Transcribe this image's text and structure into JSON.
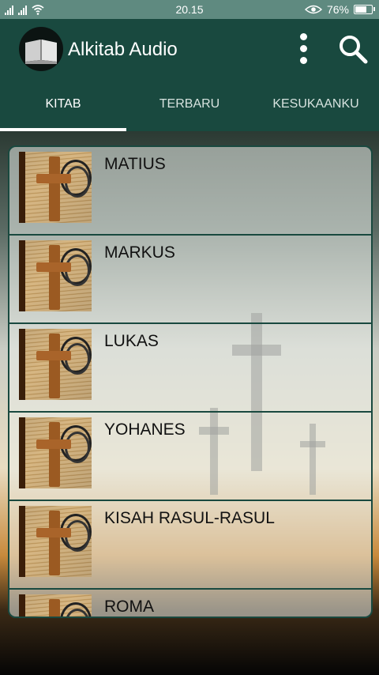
{
  "status_bar": {
    "time": "20.15",
    "battery": "76%",
    "battery_level": 0.76
  },
  "app_bar": {
    "title": "Alkitab Audio",
    "logo_icon": "bible-book-icon",
    "more_icon": "more-vert-icon",
    "search_icon": "search-icon",
    "background": "#19493f"
  },
  "tabs": [
    {
      "label": "KITAB",
      "active": true
    },
    {
      "label": "TERBARU",
      "active": false
    },
    {
      "label": "KESUKAANKU",
      "active": false
    }
  ],
  "books": [
    {
      "name": "MATIUS"
    },
    {
      "name": "MARKUS"
    },
    {
      "name": "LUKAS"
    },
    {
      "name": "YOHANES"
    },
    {
      "name": "KISAH RASUL-RASUL"
    },
    {
      "name": "ROMA"
    }
  ]
}
